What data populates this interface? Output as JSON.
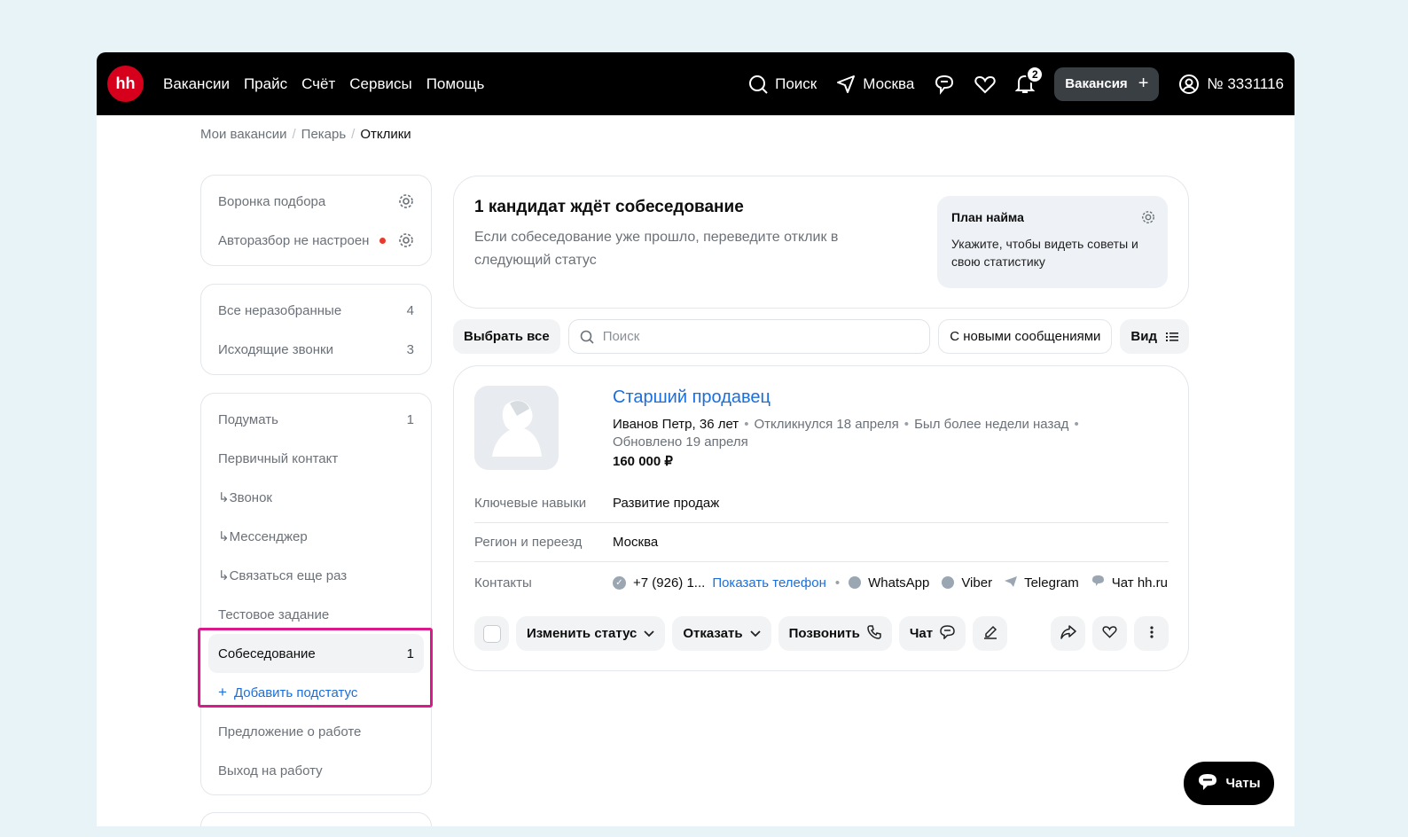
{
  "topbar": {
    "logo": "hh",
    "nav": [
      "Вакансии",
      "Прайс",
      "Счёт",
      "Сервисы",
      "Помощь"
    ],
    "search_label": "Поиск",
    "city_label": "Москва",
    "notifications_count": "2",
    "vacancy_button": "Вакансия",
    "account": "№ 3331116"
  },
  "breadcrumbs": [
    "Мои вакансии",
    "Пекарь",
    "Отклики"
  ],
  "sidebar": {
    "box1": [
      {
        "label": "Воронка подбора"
      },
      {
        "label": "Авторазбор не настроен"
      }
    ],
    "box2": [
      {
        "label": "Все неразобранные",
        "count": "4"
      },
      {
        "label": "Исходящие звонки",
        "count": "3"
      }
    ],
    "box3": [
      {
        "label": "Подумать",
        "count": "1"
      },
      {
        "label": "Первичный контакт"
      },
      {
        "label": "Звонок"
      },
      {
        "label": "Мессенджер"
      },
      {
        "label": "Связаться еще раз"
      },
      {
        "label": "Тестовое задание"
      },
      {
        "label": "Собеседование",
        "count": "1"
      },
      {
        "label": "Добавить подстатус"
      },
      {
        "label": "Предложение о работе"
      },
      {
        "label": "Выход на работу"
      }
    ]
  },
  "info": {
    "title": "1 кандидат ждёт собеседование",
    "text": "Если собеседование уже прошло, переведите отклик в следующий статус",
    "plan_title": "План найма",
    "plan_text": "Укажите, чтобы видеть советы и свою статистику"
  },
  "toolbar": {
    "select_all": "Выбрать все",
    "search_placeholder": "Поиск",
    "new_messages": "С новыми сообщениями",
    "view": "Вид"
  },
  "candidate": {
    "job_title": "Старший продавец",
    "name": "Иванов Петр, 36 лет",
    "responded": "Откликнулся 18 апреля",
    "last_seen": "Был более недели назад",
    "updated": "Обновлено 19 апреля",
    "salary": "160 000 ₽",
    "skills_label": "Ключевые навыки",
    "skills": "Развитие продаж",
    "region_label": "Регион и переезд",
    "region": "Москва",
    "contacts_label": "Контакты",
    "phone": "+7 (926) 1...",
    "show_phone": "Показать телефон",
    "whatsapp": "WhatsApp",
    "viber": "Viber",
    "telegram": "Telegram",
    "chat_hh": "Чат hh.ru"
  },
  "actions": {
    "change_status": "Изменить статус",
    "reject": "Отказать",
    "call": "Позвонить",
    "chat": "Чат"
  },
  "chats_button": "Чаты",
  "colors": {
    "accent": "#1b6fdc",
    "brand": "#d6001c",
    "highlight": "#d91a8a"
  }
}
